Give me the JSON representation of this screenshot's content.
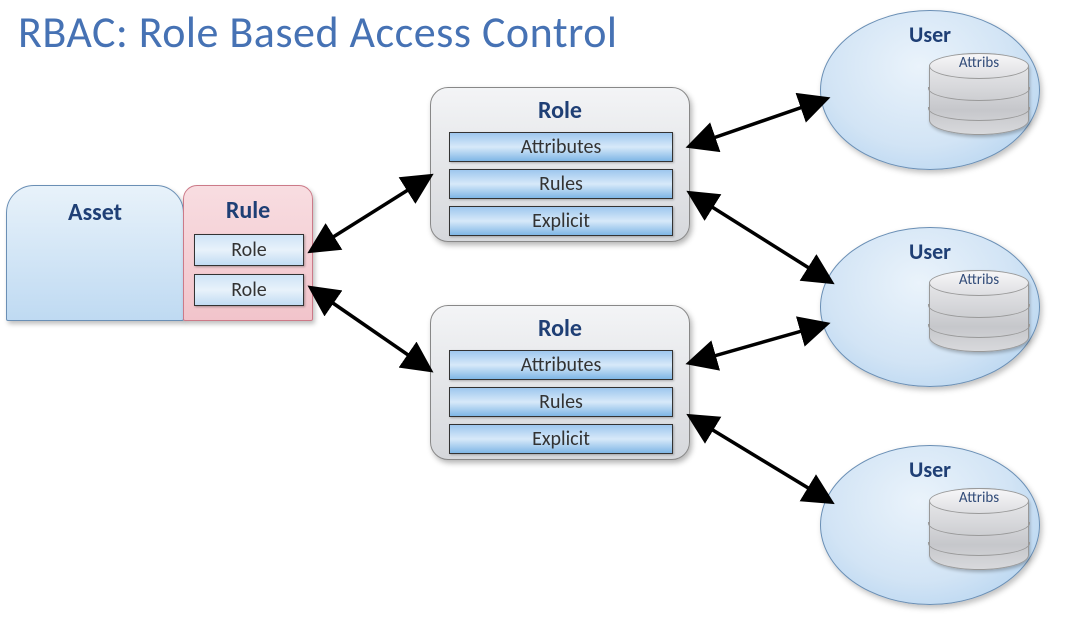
{
  "title": "RBAC: Role Based Access Control",
  "asset": {
    "label": "Asset"
  },
  "rule": {
    "label": "Rule",
    "roles": [
      "Role",
      "Role"
    ]
  },
  "role_cards": [
    {
      "label": "Role",
      "items": [
        "Attributes",
        "Rules",
        "Explicit"
      ]
    },
    {
      "label": "Role",
      "items": [
        "Attributes",
        "Rules",
        "Explicit"
      ]
    }
  ],
  "users": [
    {
      "label": "User",
      "attribs": "Attribs"
    },
    {
      "label": "User",
      "attribs": "Attribs"
    },
    {
      "label": "User",
      "attribs": "Attribs"
    }
  ]
}
